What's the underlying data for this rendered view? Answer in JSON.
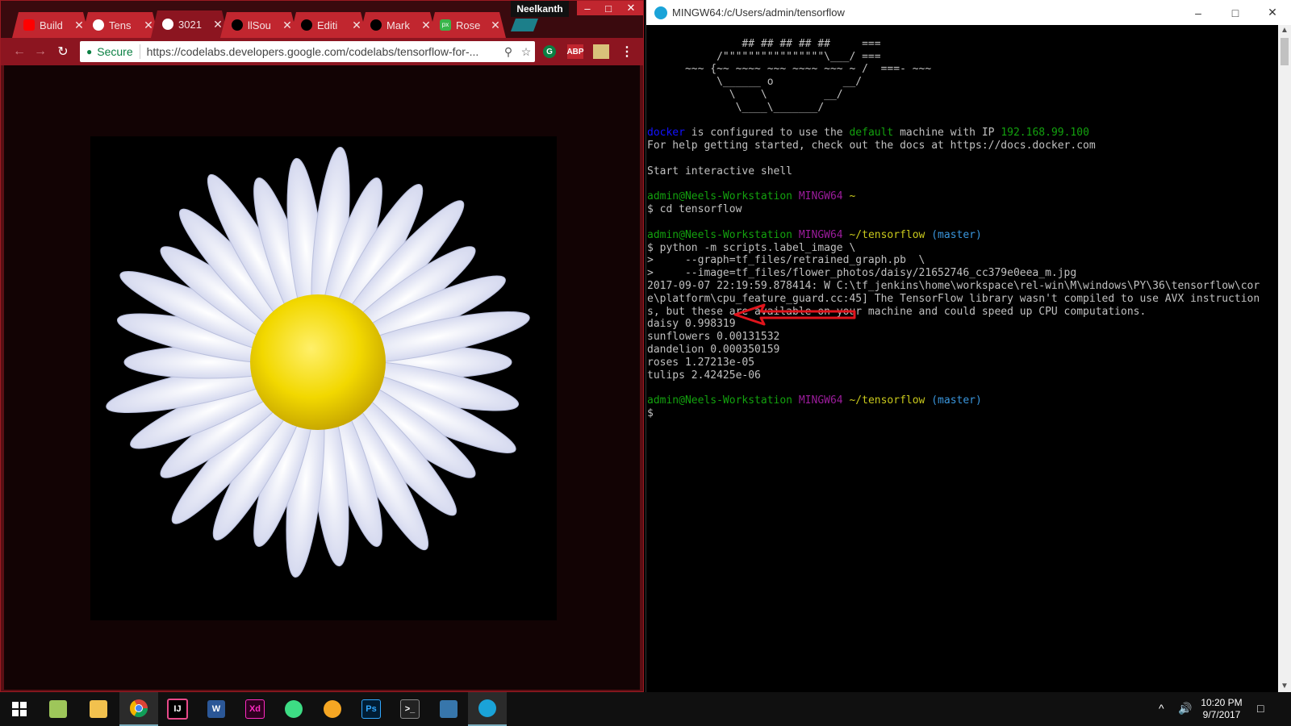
{
  "chrome": {
    "profile_name": "Neelkanth",
    "tabs": [
      {
        "label": "Build",
        "favicon_color": "#ff0000",
        "icon": "youtube-icon"
      },
      {
        "label": "Tens",
        "favicon_color": "#ffffff",
        "icon": "codelabs-icon"
      },
      {
        "label": "3021",
        "favicon_color": "#ffffff",
        "icon": "codelabs-icon"
      },
      {
        "label": "llSou",
        "favicon_color": "#000000",
        "icon": "github-icon"
      },
      {
        "label": "Editi",
        "favicon_color": "#000000",
        "icon": "github-icon"
      },
      {
        "label": "Mark",
        "favicon_color": "#000000",
        "icon": "github-icon"
      },
      {
        "label": "Rose",
        "favicon_color": "#39b54a",
        "icon": "pixabay-icon"
      }
    ],
    "secure_label": "Secure",
    "url": "https://codelabs.developers.google.com/codelabs/tensorflow-for-...",
    "ext_abp": "ABP"
  },
  "terminal": {
    "title": "MINGW64:/c/Users/admin/tensorflow",
    "ascii": [
      "               ## ## ## ## ##     ===",
      "           /\"\"\"\"\"\"\"\"\"\"\"\"\"\"\"\"\\___/ ===",
      "      ~~~ {~~ ~~~~ ~~~ ~~~~ ~~~ ~ /  ===- ~~~",
      "           \\______ o           __/",
      "             \\    \\         __/",
      "              \\____\\_______/"
    ],
    "docker_word": "docker",
    "docker_mid": " is configured to use the ",
    "default_word": "default",
    "docker_mid2": " machine with IP ",
    "ip": "192.168.99.100",
    "help_line": "For help getting started, check out the docs at https://docs.docker.com",
    "start_line": "Start interactive shell",
    "prompt_user": "admin@Neels-Workstation",
    "prompt_env": "MINGW64",
    "prompt_home": "~",
    "cmd_cd": "$ cd tensorflow",
    "prompt_dir": "~/tensorflow",
    "prompt_branch": "(master)",
    "cmd_python": "$ python -m scripts.label_image \\",
    "cmd_graph": ">     --graph=tf_files/retrained_graph.pb  \\",
    "cmd_image": ">     --image=tf_files/flower_photos/daisy/21652746_cc379e0eea_m.jpg",
    "warn_lines": [
      "2017-09-07 22:19:59.878414: W C:\\tf_jenkins\\home\\workspace\\rel-win\\M\\windows\\PY\\36\\tensorflow\\cor",
      "e\\platform\\cpu_feature_guard.cc:45] The TensorFlow library wasn't compiled to use AVX instruction",
      "s, but these are available on your machine and could speed up CPU computations."
    ],
    "results": [
      "daisy 0.998319",
      "sunflowers 0.00131532",
      "dandelion 0.000350159",
      "roses 1.27213e-05",
      "tulips 2.42425e-06"
    ],
    "final_prompt": "$"
  },
  "taskbar": {
    "time": "10:20 PM",
    "date": "9/7/2017",
    "apps": [
      "windows-start",
      "notepad",
      "file-explorer",
      "chrome",
      "intellij",
      "word",
      "adobe-xd",
      "android-studio",
      "tutanota",
      "photoshop",
      "terminal",
      "python",
      "docker"
    ]
  }
}
